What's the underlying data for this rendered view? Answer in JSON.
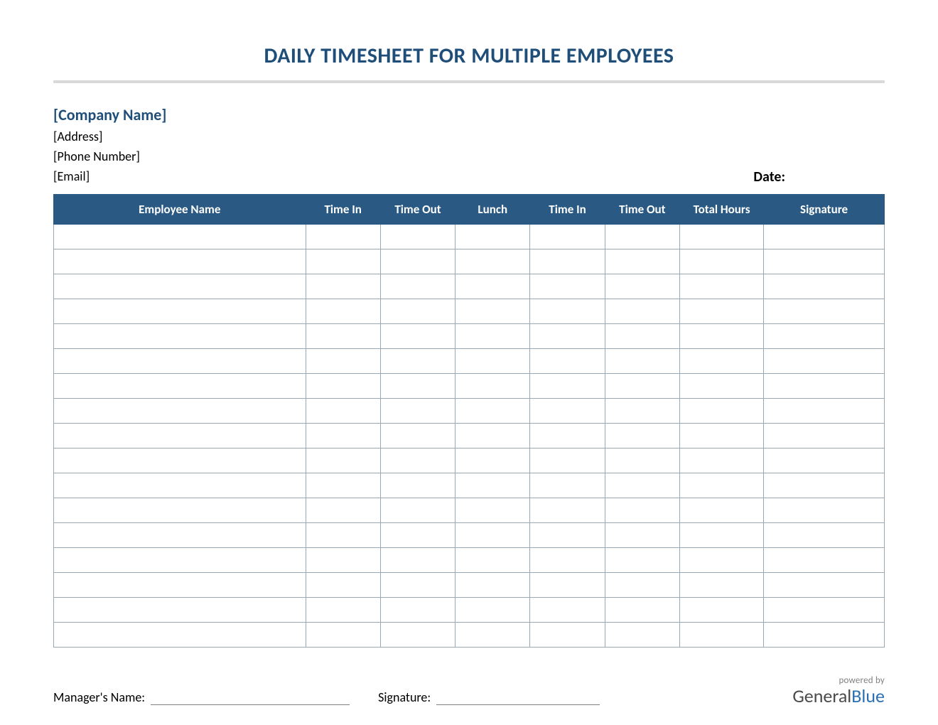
{
  "title": "DAILY TIMESHEET FOR MULTIPLE EMPLOYEES",
  "company": {
    "name": "[Company Name]",
    "address": "[Address]",
    "phone": "[Phone Number]",
    "email": "[Email]"
  },
  "date_label": "Date:",
  "columns": [
    "Employee Name",
    "Time In",
    "Time Out",
    "Lunch",
    "Time In",
    "Time Out",
    "Total Hours",
    "Signature"
  ],
  "row_count": 17,
  "footer": {
    "manager_label": "Manager's Name:",
    "signature_label": "Signature:"
  },
  "branding": {
    "powered": "powered by",
    "name_part1": "General",
    "name_part2": "Blue"
  },
  "colors": {
    "primary": "#1f4e79",
    "table_header": "#2a5a84",
    "divider": "#d9d9d9",
    "border": "#9aa8b3"
  }
}
